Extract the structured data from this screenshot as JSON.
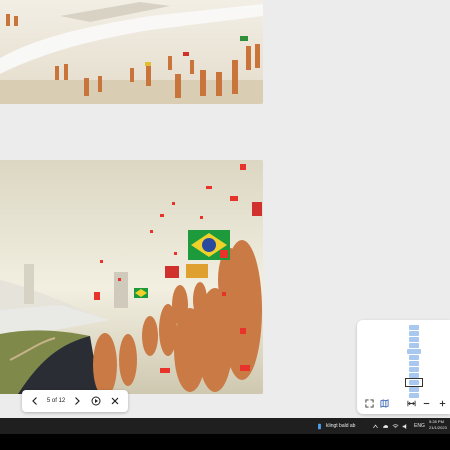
{
  "viewer": {
    "slides": [
      {
        "name": "slide-4-preview",
        "description_icon": "stadium-crowd-render-image"
      },
      {
        "name": "slide-5-current",
        "description_icon": "brazil-fans-render-image"
      }
    ],
    "toolbar": {
      "page_indicator": "5 of 12",
      "prev_icon": "chevron-left-icon",
      "next_icon": "chevron-right-icon",
      "play_icon": "play-circle-icon",
      "close_icon": "close-icon"
    },
    "zoom_panel": {
      "thumbnail_count": 12,
      "current_index": 5,
      "icons": [
        "fullscreen-icon",
        "map-icon",
        "fit-width-icon",
        "zoom-out-icon",
        "zoom-in-icon"
      ]
    }
  },
  "taskbar": {
    "notification_text": "klingt bald ab",
    "language": "ENG",
    "time": "5:28 PM",
    "date": "21/1/2023",
    "colors": {
      "taskbar_bg": "#1f1f1f",
      "accent": "#4aa3f0"
    }
  }
}
